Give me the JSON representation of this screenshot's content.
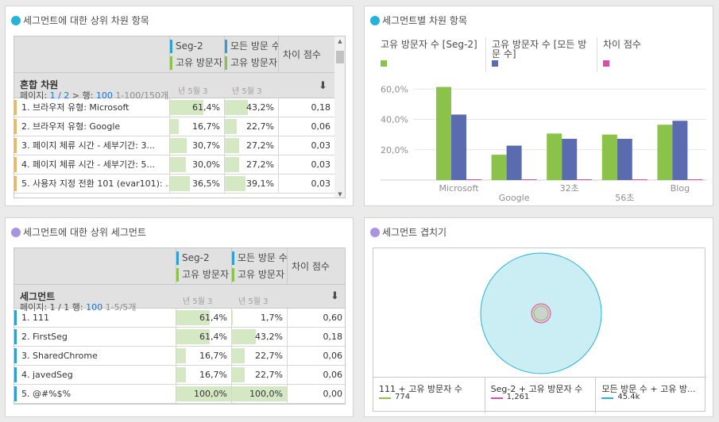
{
  "panels": {
    "top_dims": {
      "title": "세그먼트에 대한 상위 차원 항목",
      "dot_color": "#26b3d9"
    },
    "chart": {
      "title": "세그먼트별 차원 항목",
      "dot_color": "#26b3d9"
    },
    "top_segs": {
      "title": "세그먼트에 대한 상위 세그먼트",
      "dot_color": "#a794e3"
    },
    "venn": {
      "title": "세그먼트 겹치기",
      "dot_color": "#a794e3"
    }
  },
  "table1": {
    "col1": {
      "segment": "Seg-2",
      "metric": "고유 방문자"
    },
    "col2": {
      "segment": "모든 방문 수",
      "metric": "고유 방문자"
    },
    "col3": "차이 점수",
    "dim_title": "혼합 차원",
    "page_label": "페이지:",
    "page_value": "1 / 2",
    "page_next": ">",
    "rows_label": "행:",
    "rows_value": "100",
    "range": "1-100/150개",
    "spark": "년 5월 3",
    "rows": [
      {
        "label": "1.  브라우저 유형: Microsoft",
        "c1": "61,4%",
        "p1": 61.4,
        "c2": "43,2%",
        "p2": 43.2,
        "c3": "0,18",
        "bar": "#e8b56d"
      },
      {
        "label": "2.  브라우저 유형: Google",
        "c1": "16,7%",
        "p1": 16.7,
        "c2": "22,7%",
        "p2": 22.7,
        "c3": "0,06",
        "bar": "#e8b56d"
      },
      {
        "label": "3.  페이지 체류 시간 - 세부기간: 3...",
        "c1": "30,7%",
        "p1": 30.7,
        "c2": "27,2%",
        "p2": 27.2,
        "c3": "0,03",
        "bar": "#e8b56d"
      },
      {
        "label": "4.  페이지 체류 시간 - 세부기간: 5...",
        "c1": "30,0%",
        "p1": 30.0,
        "c2": "27,2%",
        "p2": 27.2,
        "c3": "0,03",
        "bar": "#e8b56d"
      },
      {
        "label": "5.  사용자 지정 전환 101 (evar101): ...",
        "c1": "36,5%",
        "p1": 36.5,
        "c2": "39,1%",
        "p2": 39.1,
        "c3": "0,03",
        "bar": "#e8b56d"
      }
    ]
  },
  "table2": {
    "col1": {
      "segment": "Seg-2",
      "metric": "고유 방문자"
    },
    "col2": {
      "segment": "모든 방문 수",
      "metric": "고유 방문자"
    },
    "col3": "차이 점수",
    "dim_title": "세그먼트",
    "page_label": "페이지:",
    "page_value": "1 / 1",
    "rows_label": "행:",
    "rows_value": "100",
    "range": "1-5/5개",
    "spark": "년 5월 3",
    "rows": [
      {
        "label": "1.  111",
        "c1": "61,4%",
        "p1": 61.4,
        "c2": "1,7%",
        "p2": 1.7,
        "c3": "0,60",
        "bar": "#2d9fd9"
      },
      {
        "label": "2.  FirstSeg",
        "c1": "61,4%",
        "p1": 61.4,
        "c2": "43,2%",
        "p2": 43.2,
        "c3": "0,18",
        "bar": "#2d9fd9"
      },
      {
        "label": "3.  SharedChrome",
        "c1": "16,7%",
        "p1": 16.7,
        "c2": "22,7%",
        "p2": 22.7,
        "c3": "0,06",
        "bar": "#2d9fd9"
      },
      {
        "label": "4.  javedSeg",
        "c1": "16,7%",
        "p1": 16.7,
        "c2": "22,7%",
        "p2": 22.7,
        "c3": "0,06",
        "bar": "#2d9fd9"
      },
      {
        "label": "5.  @#%$%",
        "c1": "100,0%",
        "p1": 100,
        "c2": "100,0%",
        "p2": 100,
        "c3": "0,00",
        "bar": "#2d9fd9"
      }
    ]
  },
  "chart_data": {
    "type": "bar",
    "categories": [
      "Microsoft",
      "Google",
      "32초",
      "56초",
      "Blog"
    ],
    "series": [
      {
        "name": "고유 방문자 수 [Seg-2]",
        "values": [
          61.4,
          16.7,
          30.7,
          30.0,
          36.5
        ],
        "color": "#8bc34a"
      },
      {
        "name": "고유 방문자 수 [모든 방문 수]",
        "values": [
          43.2,
          22.7,
          27.2,
          27.2,
          39.1
        ],
        "color": "#5b6bb0"
      },
      {
        "name": "차이 점수",
        "values": [
          0.18,
          0.06,
          0.03,
          0.03,
          0.03
        ],
        "color": "#d94fa8"
      }
    ],
    "yticks": [
      "20,0%",
      "40,0%",
      "60,0%"
    ],
    "ytick_values": [
      20,
      40,
      60
    ],
    "ylim": [
      0,
      68
    ],
    "grid": true,
    "legend": "top"
  },
  "venn": {
    "legend": [
      {
        "name": "111 + 고유 방문자 수",
        "value": "774",
        "color": "#8bc34a"
      },
      {
        "name": "Seg-2 + 고유 방문자 수",
        "value": "1,261",
        "color": "#d94fa8"
      },
      {
        "name": "모든 방문 수 + 고유 방...",
        "value": "45.4k",
        "color": "#26b3d9"
      }
    ]
  }
}
